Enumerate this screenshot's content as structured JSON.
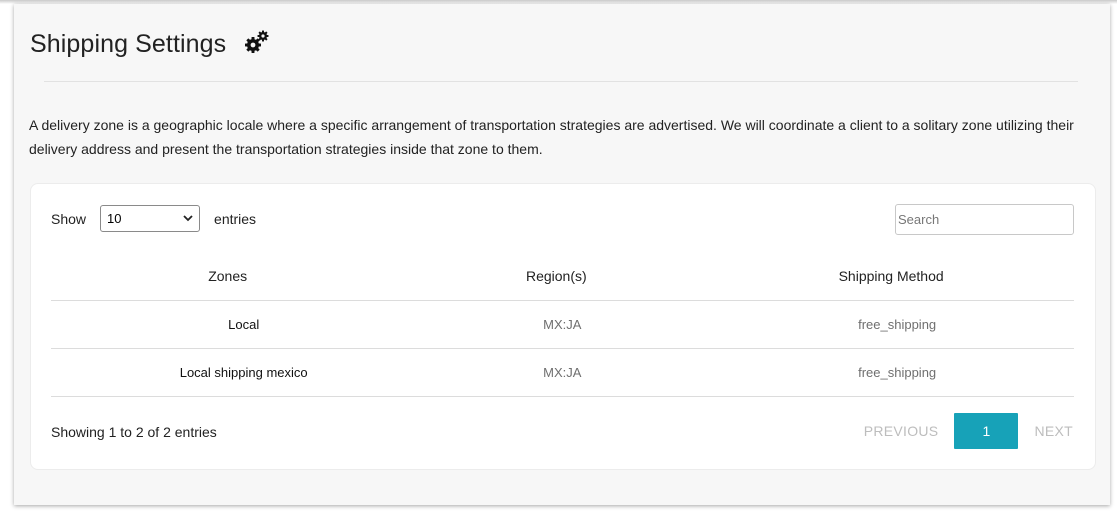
{
  "page": {
    "title": "Shipping Settings",
    "icon": "gears-icon",
    "description": "A delivery zone is a geographic locale where a specific arrangement of transportation strategies are advertised. We will coordinate a client to a solitary zone utilizing their delivery address and present the transportation strategies inside that zone to them."
  },
  "table_controls": {
    "show_label": "Show",
    "page_length": "10",
    "entries_label": "entries",
    "search_placeholder": "Search"
  },
  "table": {
    "headers": [
      "Zones",
      "Region(s)",
      "Shipping Method"
    ],
    "rows": [
      {
        "zone": "Local",
        "regions": "MX:JA",
        "method": "free_shipping"
      },
      {
        "zone": "Local shipping mexico",
        "regions": "MX:JA",
        "method": "free_shipping"
      }
    ]
  },
  "footer": {
    "info": "Showing 1 to 2 of 2 entries",
    "previous_label": "PREVIOUS",
    "current_page": "1",
    "next_label": "NEXT"
  },
  "colors": {
    "accent": "#17a2b8",
    "background": "#f7f7f7",
    "card": "#ffffff"
  }
}
